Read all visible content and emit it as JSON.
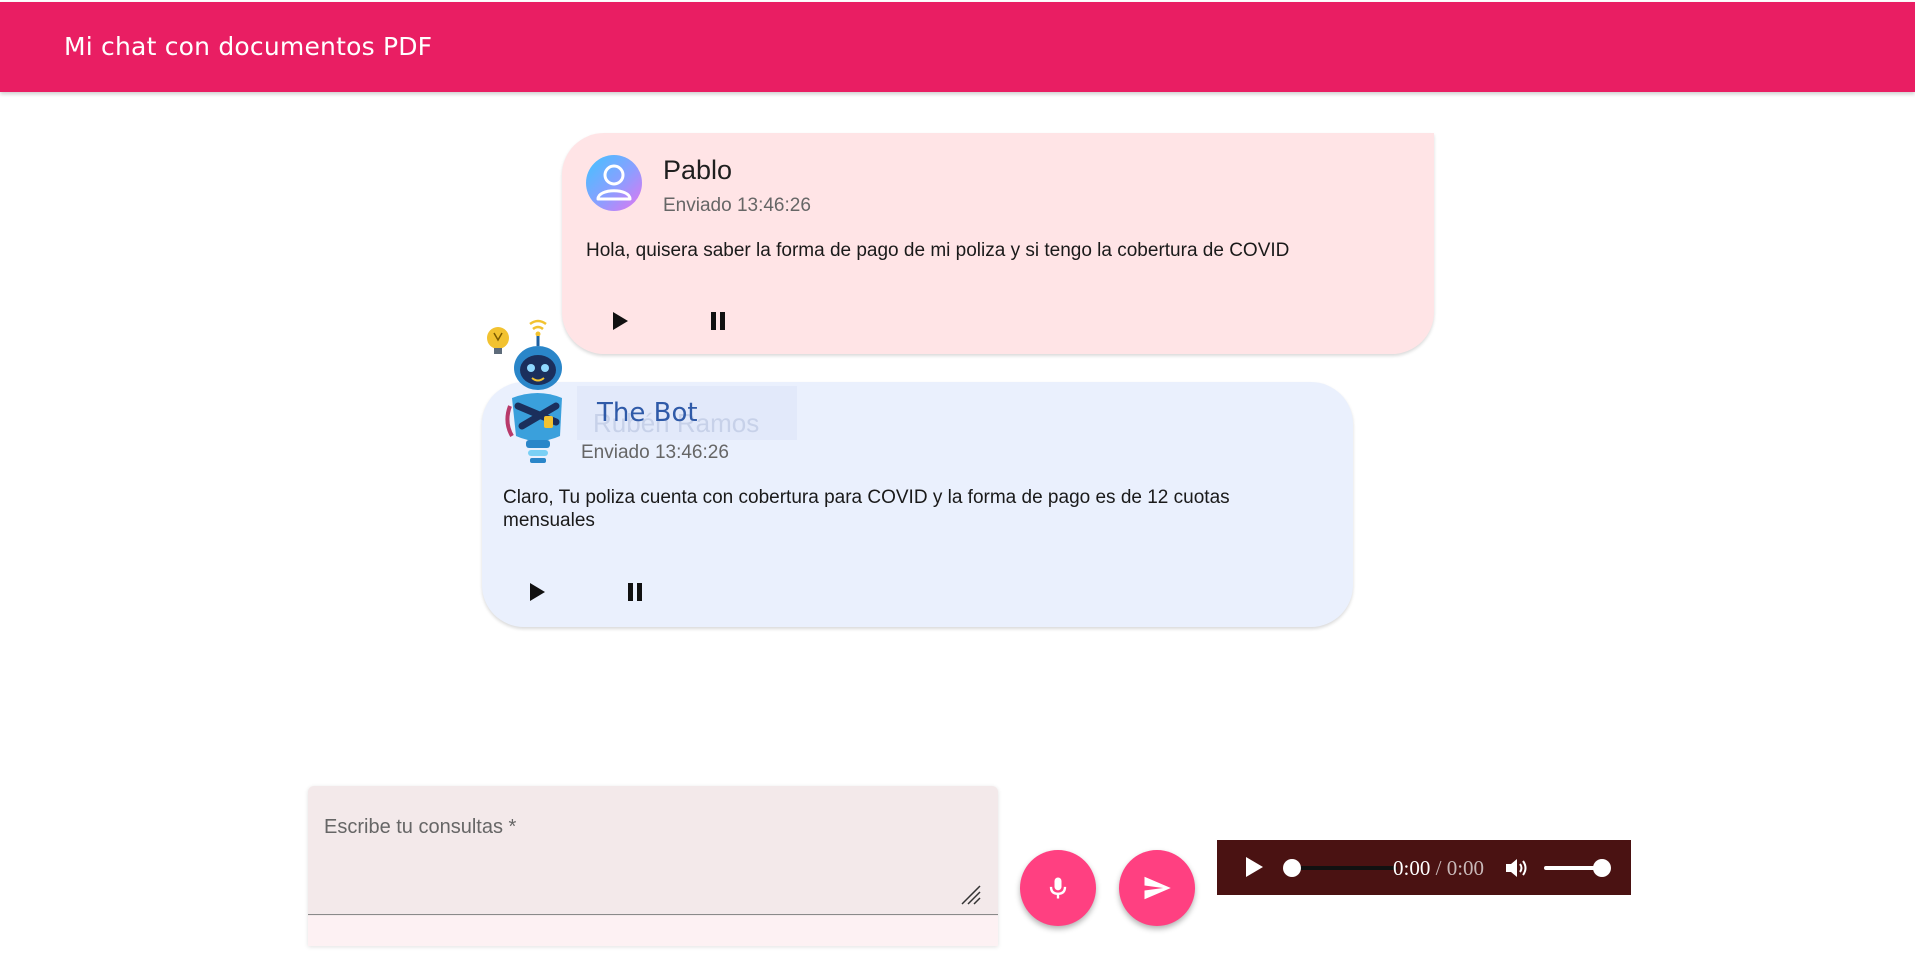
{
  "appbar": {
    "title": "Mi chat con documentos PDF",
    "color": "#e91e63"
  },
  "messages": [
    {
      "sender": "Pablo",
      "sent": "Enviado 13:46:26",
      "text": "Hola, quisera saber la forma de pago de mi poliza y si tengo la cobertura de COVID",
      "avatar_icon": "user-avatar-icon",
      "background": "#ffe4e6",
      "controls": [
        "play-icon",
        "pause-icon"
      ]
    },
    {
      "sender": "The Bot",
      "ghost_label": "Rubén Ramos",
      "sent": "Enviado 13:46:26",
      "text": "Claro, Tu poliza cuenta con cobertura para COVID y la forma de pago es de 12 cuotas mensuales",
      "avatar_icon": "robot-mascot-icon",
      "background": "#eaf0fd",
      "controls": [
        "play-icon",
        "pause-icon"
      ]
    }
  ],
  "input": {
    "placeholder": "Escribe tu consultas *",
    "value": ""
  },
  "actions": {
    "mic_icon": "microphone-icon",
    "send_icon": "send-icon",
    "accent": "#ff4081"
  },
  "audio_player": {
    "current_time": "0:00",
    "separator": "/",
    "duration": "0:00",
    "progress": 0,
    "volume": 1,
    "background": "#4a1212"
  }
}
